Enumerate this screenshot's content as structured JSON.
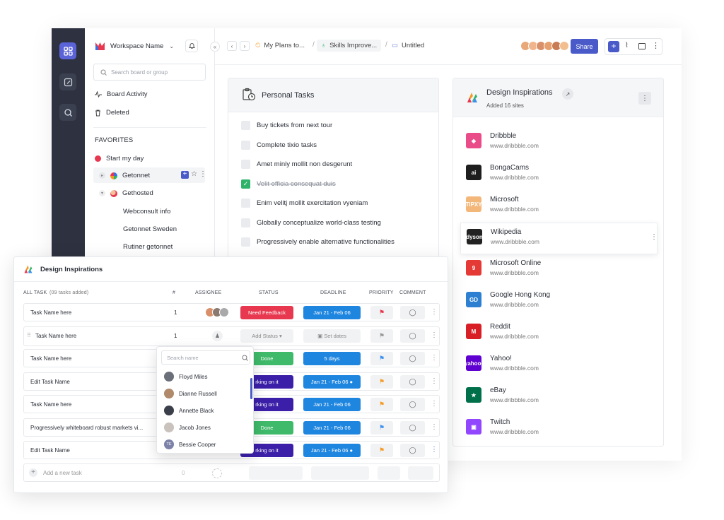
{
  "sidebar": {
    "workspace_name": "Workspace Name",
    "search_placeholder": "Search board or group",
    "board_activity": "Board Activity",
    "deleted": "Deleted",
    "favorites_label": "FAVORITES",
    "items": [
      {
        "label": "Start my day"
      },
      {
        "label": "Getonnet"
      },
      {
        "label": "Gethosted"
      },
      {
        "label": "Webconsult info"
      },
      {
        "label": "Getonnet Sweden"
      },
      {
        "label": "Rutiner getonnet"
      }
    ]
  },
  "topbar": {
    "breadcrumbs": [
      "My Plans to...",
      "Skills Improve...",
      "Untitled"
    ],
    "share_label": "Share"
  },
  "personal_tasks": {
    "title": "Personal Tasks",
    "tasks": [
      {
        "text": "Buy tickets from next tour",
        "done": false
      },
      {
        "text": "Complete tixio tasks",
        "done": false
      },
      {
        "text": "Amet miniy mollit non desgerunt",
        "done": false
      },
      {
        "text": "Velit officia consequat duis",
        "done": true
      },
      {
        "text": "Enim velitj mollit exercitation vyeniam",
        "done": false
      },
      {
        "text": "Globally conceptualize world-class testing",
        "done": false
      },
      {
        "text": "Progressively enable alternative functionalities",
        "done": false
      }
    ]
  },
  "design_card": {
    "title": "Design Inspirations",
    "subtitle": "Added 16 sites",
    "sites": [
      {
        "name": "Dribbble",
        "url": "www.dribbble.com",
        "color": "#ea4c89",
        "logo": "◆"
      },
      {
        "name": "BongaCams",
        "url": "www.dribbble.com",
        "color": "#1e1e1e",
        "logo": "ai"
      },
      {
        "name": "Microsoft",
        "url": "www.dribbble.com",
        "color": "#f3b77a",
        "logo": "TIPXY"
      },
      {
        "name": "Wikipedia",
        "url": "www.dribbble.com",
        "color": "#222222",
        "logo": "dyson"
      },
      {
        "name": "Microsoft Online",
        "url": "www.dribbble.com",
        "color": "#e53935",
        "logo": "9"
      },
      {
        "name": "Google Hong Kong",
        "url": "www.dribbble.com",
        "color": "#2d7fd1",
        "logo": "GD"
      },
      {
        "name": "Reddit",
        "url": "www.dribbble.com",
        "color": "#d81f26",
        "logo": "M"
      },
      {
        "name": "Yahoo!",
        "url": "www.dribbble.com",
        "color": "#5f01d1",
        "logo": "yahoo!"
      },
      {
        "name": "eBay",
        "url": "www.dribbble.com",
        "color": "#00704a",
        "logo": "★"
      },
      {
        "name": "Twitch",
        "url": "www.dribbble.com",
        "color": "#9146ff",
        "logo": "▣"
      }
    ]
  },
  "table_panel": {
    "title": "Design Inspirations",
    "headers": {
      "all_task": "ALL TASK",
      "count_note": "(09 tasks added)",
      "num": "#",
      "assignee": "ASSIGNEE",
      "status": "STATUS",
      "deadline": "DEADLINE",
      "priority": "PRIORITY",
      "comment": "COMMENT"
    },
    "rows": [
      {
        "name": "Task Name here",
        "num": "1",
        "status": "Need Feedback",
        "status_color": "#e8384f",
        "deadline": "Jan 21 - Feb 06",
        "flag": "#e8384f"
      },
      {
        "name": "Task Name here",
        "num": "1",
        "status": "Add Status",
        "status_color": "",
        "deadline": "Set dates",
        "flag": "#999999"
      },
      {
        "name": "Task Name here",
        "num": "",
        "status": "Done",
        "status_color": "#3fb96a",
        "deadline": "5 days",
        "flag": "#3a8ff0"
      },
      {
        "name": "Edit Task Name",
        "num": "",
        "status": "rking on it",
        "status_color": "#3b1fa8",
        "deadline": "Jan 21 - Feb 06",
        "flag": "#f59a23"
      },
      {
        "name": "Task Name here",
        "num": "",
        "status": "rking on it",
        "status_color": "#3b1fa8",
        "deadline": "Jan 21 - Feb 06",
        "flag": "#f59a23"
      },
      {
        "name": "Progressively whiteboard robust markets vi...",
        "num": "",
        "status": "Done",
        "status_color": "#3fb96a",
        "deadline": "Jan 21 - Feb 06",
        "flag": "#3a8ff0"
      },
      {
        "name": "Edit Task Name",
        "num": "",
        "status": "rking on it",
        "status_color": "#3b1fa8",
        "deadline": "Jan 21 - Feb 06",
        "flag": "#f59a23"
      }
    ],
    "add_task": "Add a new task",
    "add_task_num": "0"
  },
  "assignee_dropdown": {
    "placeholder": "Search name",
    "people": [
      {
        "name": "Floyd Miles",
        "color": "#6b6f7a",
        "initials": ""
      },
      {
        "name": "Dianne Russell",
        "color": "#b08a6a",
        "initials": ""
      },
      {
        "name": "Annette Black",
        "color": "#3b3f4a",
        "initials": ""
      },
      {
        "name": "Jacob Jones",
        "color": "#c9c2bd",
        "initials": ""
      },
      {
        "name": "Bessie Cooper",
        "color": "#7c82a8",
        "initials": "TE"
      }
    ]
  }
}
